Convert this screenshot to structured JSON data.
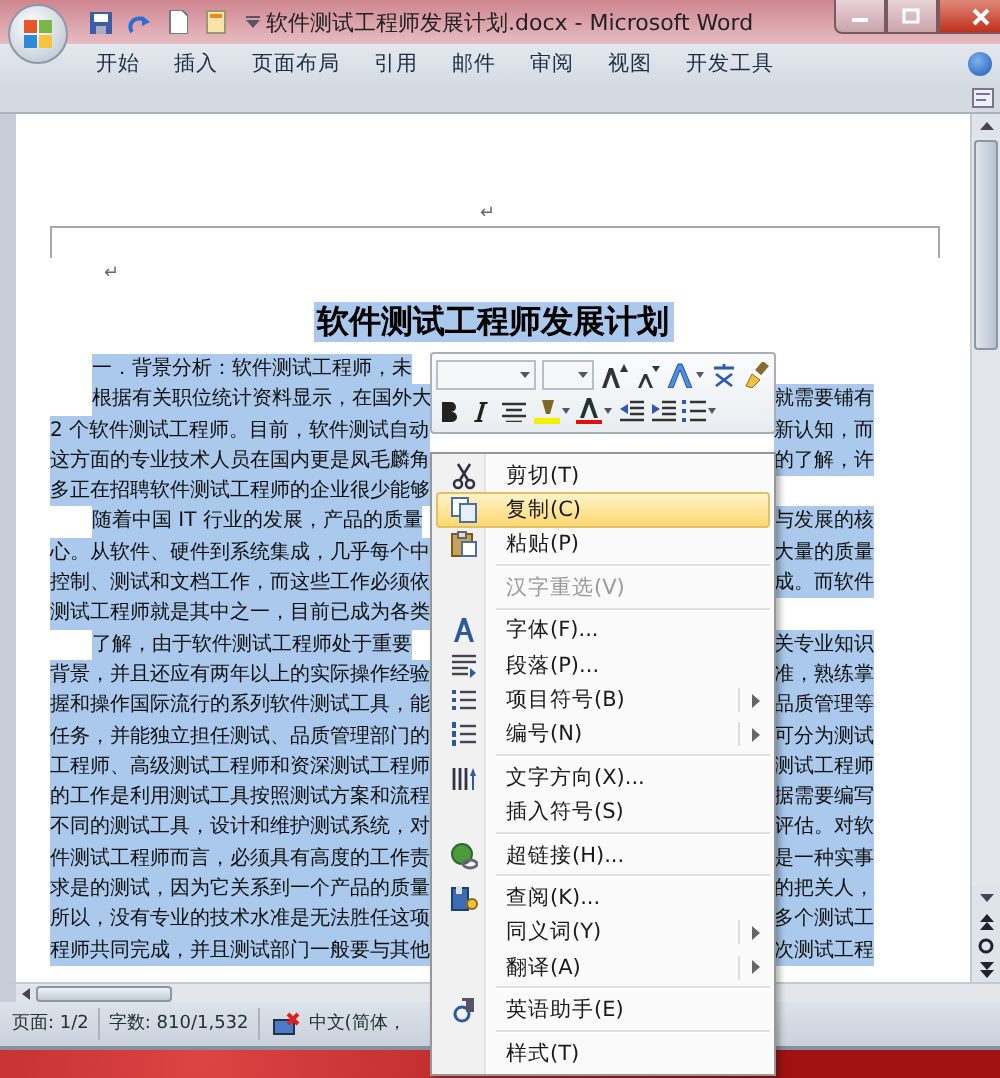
{
  "window": {
    "title": "软件测试工程师发展计划.docx - Microsoft Word"
  },
  "ribbon_tabs": [
    {
      "label": "开始",
      "selected": false
    },
    {
      "label": "插入",
      "selected": false
    },
    {
      "label": "页面布局",
      "selected": false
    },
    {
      "label": "引用",
      "selected": false
    },
    {
      "label": "邮件",
      "selected": false
    },
    {
      "label": "审阅",
      "selected": false
    },
    {
      "label": "视图",
      "selected": false
    },
    {
      "label": "开发工具",
      "selected": false
    }
  ],
  "document": {
    "header_mark": "↵",
    "body_mark": "↵",
    "title": "软件测试工程师发展计划",
    "title_selected": true,
    "lines": [
      {
        "left": "一．背景分析：软件测试工程师，未",
        "indent": true,
        "selected": true
      },
      {
        "left": "根据有关职位统计资料显示，在国外大",
        "right": "就需要铺有",
        "indent": true,
        "selected": true
      },
      {
        "left": "2 个软件测试工程师。目前，软件测试自动",
        "right": "新认知，而",
        "indent": false,
        "selected": true
      },
      {
        "left": "这方面的专业技术人员在国内更是凤毛麟角",
        "right": "的了解，许",
        "indent": false,
        "selected": true
      },
      {
        "left": "多正在招聘软件测试工程师的企业很少能够",
        "indent": false,
        "selected": true
      },
      {
        "left": "随着中国 IT 行业的发展，产品的质量",
        "right": "与发展的核",
        "indent": true,
        "selected": true
      },
      {
        "left": "心。从软件、硬件到系统集成，几乎每个中",
        "right": "大量的质量",
        "indent": false,
        "selected": true
      },
      {
        "left": "控制、测试和文档工作，而这些工作必须依",
        "right": "成。而软件",
        "indent": false,
        "selected": true
      },
      {
        "left": "测试工程师就是其中之一，目前已成为各类",
        "indent": false,
        "selected": true
      },
      {
        "left": "了解，由于软件测试工程师处于重要",
        "right": "关专业知识",
        "indent": true,
        "selected": true
      },
      {
        "left": "背景，并且还应有两年以上的实际操作经验",
        "right": "准，熟练掌",
        "indent": false,
        "selected": true
      },
      {
        "left": "握和操作国际流行的系列软件测试工具，能",
        "right": "品质管理等",
        "indent": false,
        "selected": true
      },
      {
        "left": "任务，并能独立担任测试、品质管理部门的",
        "right": "可分为测试",
        "indent": false,
        "selected": true
      },
      {
        "left": "工程师、高级测试工程师和资深测试工程师",
        "right": "测试工程师",
        "indent": false,
        "selected": true
      },
      {
        "left": "的工作是利用测试工具按照测试方案和流程",
        "right": "据需要编写",
        "indent": false,
        "selected": true
      },
      {
        "left": "不同的测试工具，设计和维护测试系统，对",
        "right": "评估。对软",
        "indent": false,
        "selected": true
      },
      {
        "left": "件测试工程师而言，必须具有高度的工作责",
        "right": "是一种实事",
        "indent": false,
        "selected": true
      },
      {
        "left": "求是的测试，因为它关系到一个产品的质量",
        "right": "的把关人，",
        "indent": false,
        "selected": true
      },
      {
        "left": "所以，没有专业的技术水准是无法胜任这项",
        "right": "多个测试工",
        "indent": false,
        "selected": true
      },
      {
        "left": "程师共同完成，并且测试部门一般要与其他",
        "right": "次测试工程",
        "indent": false,
        "selected": true
      }
    ]
  },
  "context_menu": {
    "items": [
      {
        "kind": "item",
        "label": "剪切(T)",
        "selected": false,
        "disabled": false,
        "submenu": false
      },
      {
        "kind": "item",
        "label": "复制(C)",
        "selected": true,
        "disabled": false,
        "submenu": false
      },
      {
        "kind": "item",
        "label": "粘贴(P)",
        "selected": false,
        "disabled": false,
        "submenu": false
      },
      {
        "kind": "divider"
      },
      {
        "kind": "item",
        "label": "汉字重选(V)",
        "selected": false,
        "disabled": true,
        "submenu": false
      },
      {
        "kind": "divider"
      },
      {
        "kind": "item",
        "label": "字体(F)...",
        "selected": false,
        "disabled": false,
        "submenu": false
      },
      {
        "kind": "item",
        "label": "段落(P)...",
        "selected": false,
        "disabled": false,
        "submenu": false
      },
      {
        "kind": "item",
        "label": "项目符号(B)",
        "selected": false,
        "disabled": false,
        "submenu": true
      },
      {
        "kind": "item",
        "label": "编号(N)",
        "selected": false,
        "disabled": false,
        "submenu": true
      },
      {
        "kind": "divider"
      },
      {
        "kind": "item",
        "label": "文字方向(X)...",
        "selected": false,
        "disabled": false,
        "submenu": false
      },
      {
        "kind": "item",
        "label": "插入符号(S)",
        "selected": false,
        "disabled": false,
        "submenu": false
      },
      {
        "kind": "divider"
      },
      {
        "kind": "item",
        "label": "超链接(H)...",
        "selected": false,
        "disabled": false,
        "submenu": false
      },
      {
        "kind": "divider"
      },
      {
        "kind": "item",
        "label": "查阅(K)...",
        "selected": false,
        "disabled": false,
        "submenu": false
      },
      {
        "kind": "item",
        "label": "同义词(Y)",
        "selected": false,
        "disabled": false,
        "submenu": true
      },
      {
        "kind": "item",
        "label": "翻译(A)",
        "selected": false,
        "disabled": false,
        "submenu": true
      },
      {
        "kind": "divider"
      },
      {
        "kind": "item",
        "label": "英语助手(E)",
        "selected": false,
        "disabled": false,
        "submenu": false
      },
      {
        "kind": "divider"
      },
      {
        "kind": "item",
        "label": "样式(T)",
        "selected": false,
        "disabled": false,
        "submenu": false
      }
    ]
  },
  "status_bar": {
    "page": "页面: 1/2",
    "words": "字数: 810/1,532",
    "language": "中文(简体，"
  }
}
